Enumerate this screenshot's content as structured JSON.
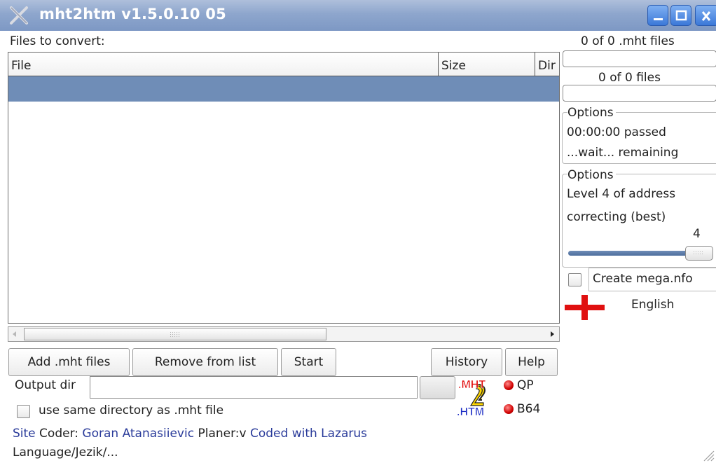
{
  "window": {
    "title": "mht2htm v1.5.0.10 05"
  },
  "list": {
    "label": "Files to convert:",
    "columns": [
      "File",
      "Size",
      "Dir"
    ]
  },
  "buttons": {
    "add": "Add .mht files",
    "remove": "Remove from list",
    "start": "Start",
    "history": "History",
    "help": "Help"
  },
  "output": {
    "label": "Output dir",
    "value": "",
    "same_dir_label": "use same directory as .mht file",
    "same_dir_checked": false
  },
  "modes": {
    "qp": "QP",
    "b64": "B64"
  },
  "logo": {
    "top": ".MHT",
    "bottom": ".HTM"
  },
  "footer": {
    "site": "Site",
    "coder_label": "Coder:",
    "coder_name": "Goran Atanasiievic",
    "planer": "Planer:v",
    "lazarus": "Coded with Lazarus",
    "language": "Language/Jezik/..."
  },
  "status": {
    "mht_count": "0 of 0 .mht files",
    "files_count": "0 of 0 files",
    "mht_progress": 0,
    "files_progress": 0
  },
  "time_group": {
    "title": "Options",
    "passed": "00:00:00 passed",
    "remaining": "...wait... remaining"
  },
  "options_group": {
    "title": "Options",
    "line1": "Level 4 of address",
    "line2": "correcting (best)",
    "level": "4",
    "level_max": 4
  },
  "mega": {
    "label": "Create mega.nfo",
    "checked": false
  },
  "language": {
    "value": "English",
    "flag": "england-flag"
  },
  "colors": {
    "titlebar": "#8ea6cd",
    "selection": "#6f8db7",
    "link": "#2a3b9a",
    "led": "#d10000"
  }
}
